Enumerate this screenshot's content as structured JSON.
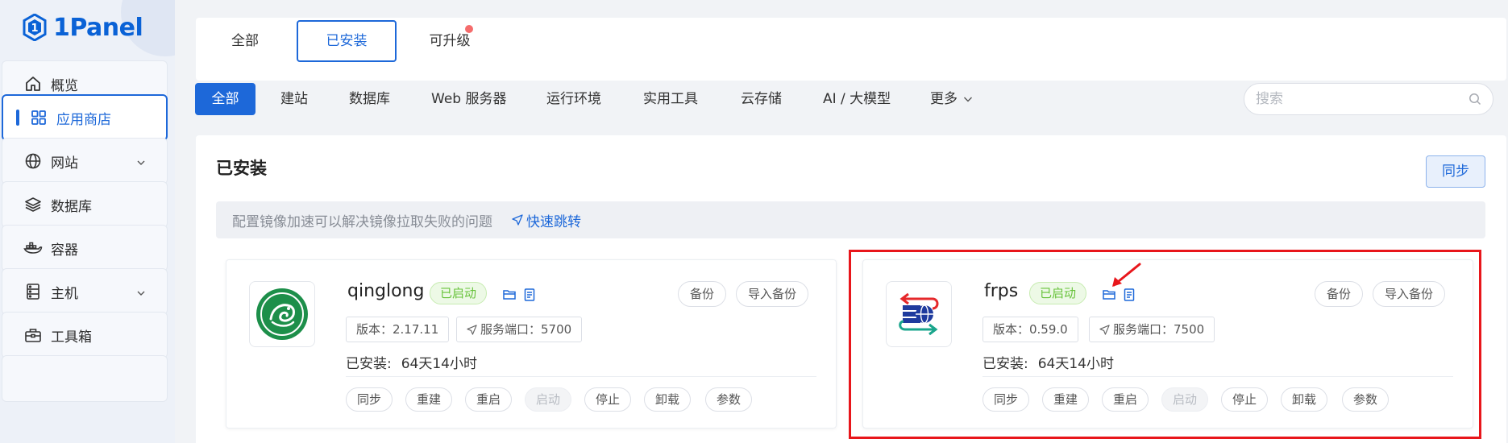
{
  "app": {
    "logo_text": "1Panel"
  },
  "sidebar": {
    "items": [
      {
        "label": "概览",
        "icon": "home-icon"
      },
      {
        "label": "应用商店",
        "icon": "grid-icon",
        "active": true
      },
      {
        "label": "网站",
        "icon": "globe-icon",
        "expandable": true
      },
      {
        "label": "数据库",
        "icon": "layers-icon"
      },
      {
        "label": "容器",
        "icon": "docker-icon"
      },
      {
        "label": "主机",
        "icon": "server-icon",
        "expandable": true
      },
      {
        "label": "工具箱",
        "icon": "toolbox-icon"
      }
    ]
  },
  "top_tabs": [
    {
      "label": "全部"
    },
    {
      "label": "已安装",
      "active": true
    },
    {
      "label": "可升级",
      "has_dot": true
    }
  ],
  "categories": [
    "全部",
    "建站",
    "数据库",
    "Web 服务器",
    "运行环境",
    "实用工具",
    "云存储",
    "AI / 大模型",
    "更多"
  ],
  "active_category": "全部",
  "search": {
    "placeholder": "搜索",
    "value": ""
  },
  "section": {
    "title": "已安装",
    "sync_label": "同步",
    "notice_text": "配置镜像加速可以解决镜像拉取失败的问题",
    "notice_link": "快速跳转"
  },
  "apps": [
    {
      "name": "qinglong",
      "status": "已启动",
      "backup_label": "备份",
      "import_backup_label": "导入备份",
      "version_text": "版本：2.17.11",
      "port_text": "服务端口：5700",
      "installed_label": "已安装:",
      "installed_value": "64天14小时",
      "actions": [
        "同步",
        "重建",
        "重启",
        "启动",
        "停止",
        "卸载",
        "参数"
      ],
      "disabled_action": "启动"
    },
    {
      "name": "frps",
      "status": "已启动",
      "backup_label": "备份",
      "import_backup_label": "导入备份",
      "version_text": "版本：0.59.0",
      "port_text": "服务端口：7500",
      "installed_label": "已安装:",
      "installed_value": "64天14小时",
      "actions": [
        "同步",
        "重建",
        "重启",
        "启动",
        "停止",
        "卸载",
        "参数"
      ],
      "disabled_action": "启动",
      "highlighted": true
    }
  ],
  "colors": {
    "primary": "#1d68d9",
    "success": "#67c23a",
    "highlight_box": "#e8161b",
    "notify_dot": "#f56c6c"
  }
}
